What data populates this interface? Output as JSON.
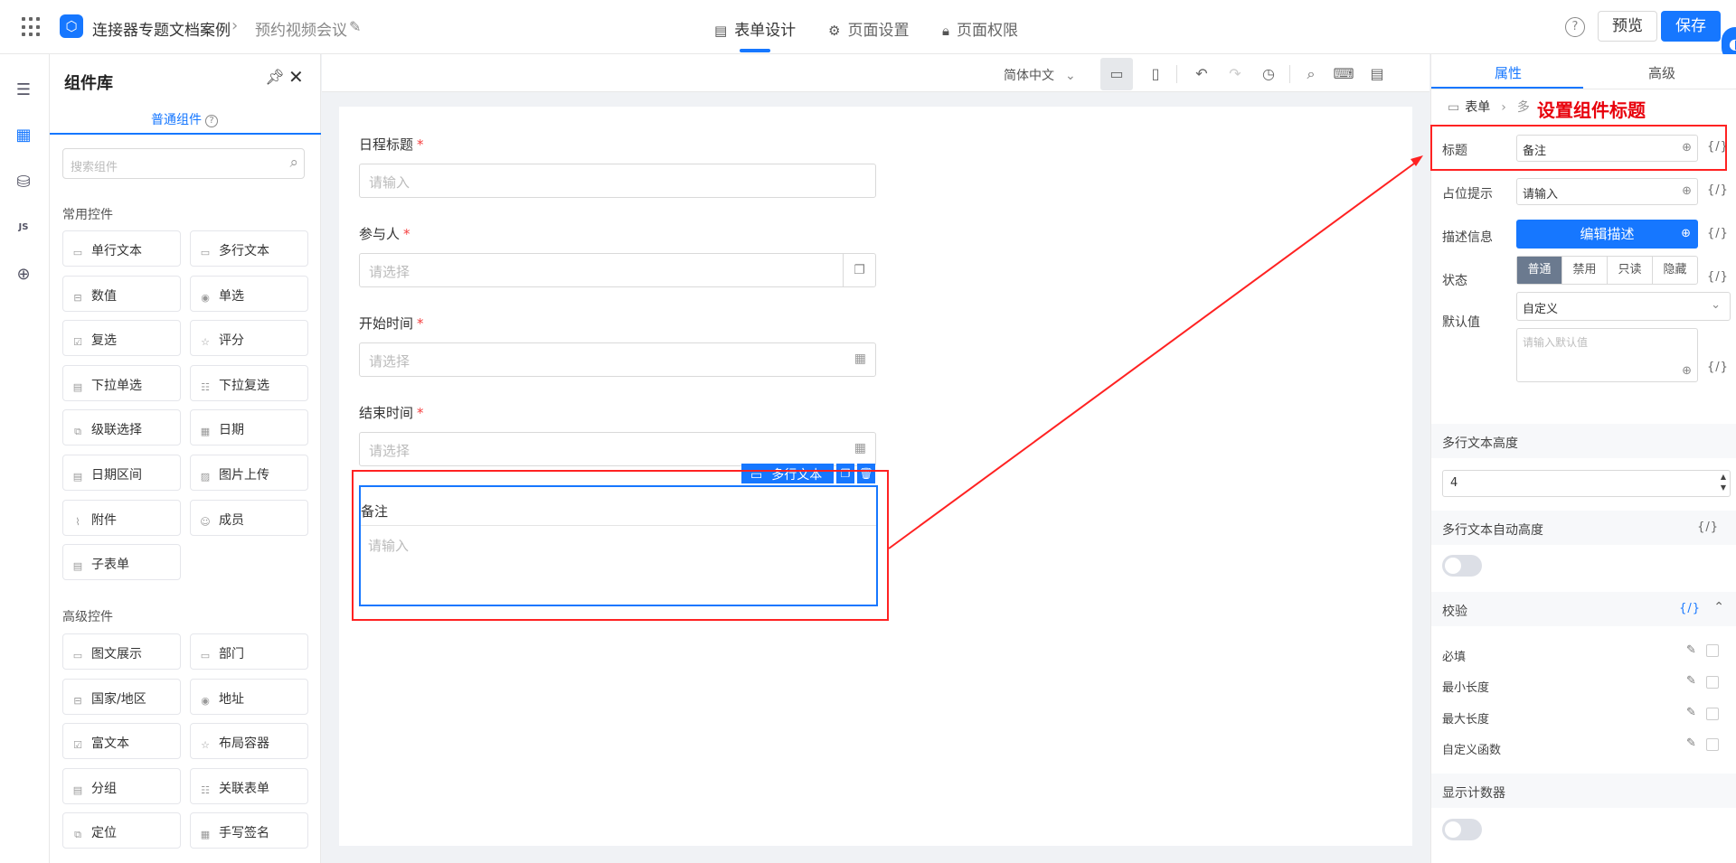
{
  "app": {
    "name": "连接器专题文档案例",
    "page": "预约视频会议",
    "tabs": [
      "表单设计",
      "页面设置",
      "页面权限"
    ],
    "preview": "预览",
    "save": "保存",
    "help": "?"
  },
  "library": {
    "title": "组件库",
    "tab": "普通组件",
    "search_placeholder": "搜索组件",
    "common_title": "常用控件",
    "common": [
      "单行文本",
      "多行文本",
      "数值",
      "单选",
      "复选",
      "评分",
      "下拉单选",
      "下拉复选",
      "级联选择",
      "日期",
      "日期区间",
      "图片上传",
      "附件",
      "成员",
      "子表单"
    ],
    "advanced_title": "高级控件",
    "advanced": [
      "图文展示",
      "部门",
      "国家/地区",
      "地址",
      "富文本",
      "布局容器",
      "分组",
      "关联表单",
      "定位",
      "手写签名"
    ]
  },
  "toolbar": {
    "lang": "简体中文"
  },
  "form": {
    "fields": [
      {
        "label": "日程标题",
        "placeholder": "请输入"
      },
      {
        "label": "参与人",
        "placeholder": "请选择"
      },
      {
        "label": "开始时间",
        "placeholder": "请选择"
      },
      {
        "label": "结束时间",
        "placeholder": "请选择"
      }
    ],
    "selected": {
      "label": "备注",
      "placeholder": "请输入",
      "tag": "多行文本"
    }
  },
  "props": {
    "tabs": [
      "属性",
      "高级"
    ],
    "crumb_root": "表单",
    "crumb_child": "多",
    "title_label": "标题",
    "title_value": "备注",
    "placeholder_label": "占位提示",
    "placeholder_value": "请输入",
    "desc_label": "描述信息",
    "desc_button": "编辑描述",
    "state_label": "状态",
    "states": [
      "普通",
      "禁用",
      "只读",
      "隐藏"
    ],
    "default_label": "默认值",
    "default_mode": "自定义",
    "default_placeholder": "请输入默认值",
    "height_title": "多行文本高度",
    "height_value": "4",
    "autoheight_title": "多行文本自动高度",
    "validate_title": "校验",
    "validations": [
      "必填",
      "最小长度",
      "最大长度",
      "自定义函数"
    ],
    "counter_title": "显示计数器",
    "fx": "{/}"
  },
  "annotation": "设置组件标题",
  "colors": {
    "accent": "#1677ff",
    "annotation": "#e8000b"
  }
}
